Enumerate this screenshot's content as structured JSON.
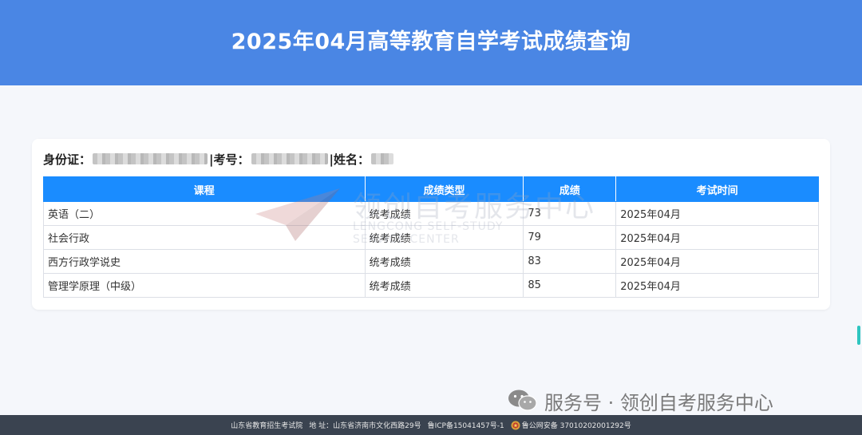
{
  "header": {
    "title": "2025年04月高等教育自学考试成绩查询"
  },
  "info": {
    "id_label": "身份证：",
    "exam_label": "|考号：",
    "name_label": "|姓名："
  },
  "table": {
    "headers": [
      "课程",
      "成绩类型",
      "成绩",
      "考试时间"
    ],
    "rows": [
      [
        "英语（二）",
        "统考成绩",
        "73",
        "2025年04月"
      ],
      [
        "社会行政",
        "统考成绩",
        "79",
        "2025年04月"
      ],
      [
        "西方行政学说史",
        "统考成绩",
        "83",
        "2025年04月"
      ],
      [
        "管理学原理（中级）",
        "统考成绩",
        "85",
        "2025年04月"
      ]
    ]
  },
  "watermark": {
    "cn": "领创自考服务中心",
    "en1": "LENGCONG SELF-STUDY",
    "en2": "SERVICE CENTER"
  },
  "wechat": {
    "label": "服务号 · 领创自考服务中心"
  },
  "footer": {
    "org": "山东省教育招生考试院",
    "address": "地 址：山东省济南市文化西路29号",
    "icp": "鲁ICP备15041457号-1",
    "police": "鲁公网安备 37010202001292号"
  },
  "colors": {
    "header_bg": "#4a86e4",
    "table_header_bg": "#1a8cff",
    "footer_bg": "#3a4350"
  }
}
